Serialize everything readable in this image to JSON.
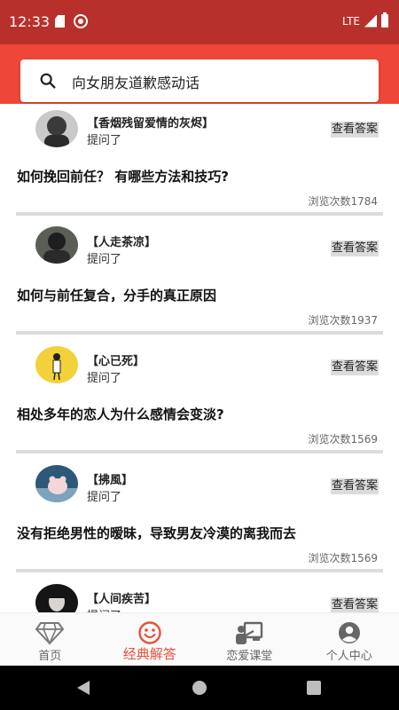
{
  "status_bar": {
    "time": "12:33",
    "network": "LTE"
  },
  "search": {
    "text": "向女朋友道歉感动话"
  },
  "feed": {
    "asked_label": "提问了",
    "answer_button_label": "查看答案",
    "posts": [
      {
        "author": "【香烟残留爱情的灰烬】",
        "question": "如何挽回前任？ 有哪些方法和技巧?",
        "views": "浏览次数1784"
      },
      {
        "author": "【人走茶凉】",
        "question": "如何与前任复合，分手的真正原因",
        "views": "浏览次数1937"
      },
      {
        "author": "【心已死】",
        "question": "相处多年的恋人为什么感情会变淡?",
        "views": "浏览次数1569"
      },
      {
        "author": "【拂風】",
        "question": "没有拒绝男性的暧昧，导致男友冷漠的离我而去",
        "views": "浏览次数1569"
      },
      {
        "author": "【人间疾苦】",
        "question": "",
        "views": ""
      }
    ]
  },
  "bottom_nav": {
    "items": [
      {
        "label": "首页",
        "icon": "diamond-icon"
      },
      {
        "label": "经典解答",
        "icon": "smile-icon"
      },
      {
        "label": "恋爱课堂",
        "icon": "classroom-icon"
      },
      {
        "label": "个人中心",
        "icon": "person-icon"
      }
    ],
    "active_index": 1
  },
  "colors": {
    "status_bar": "#b8302b",
    "header": "#ee4638",
    "accent": "#e8503c"
  }
}
